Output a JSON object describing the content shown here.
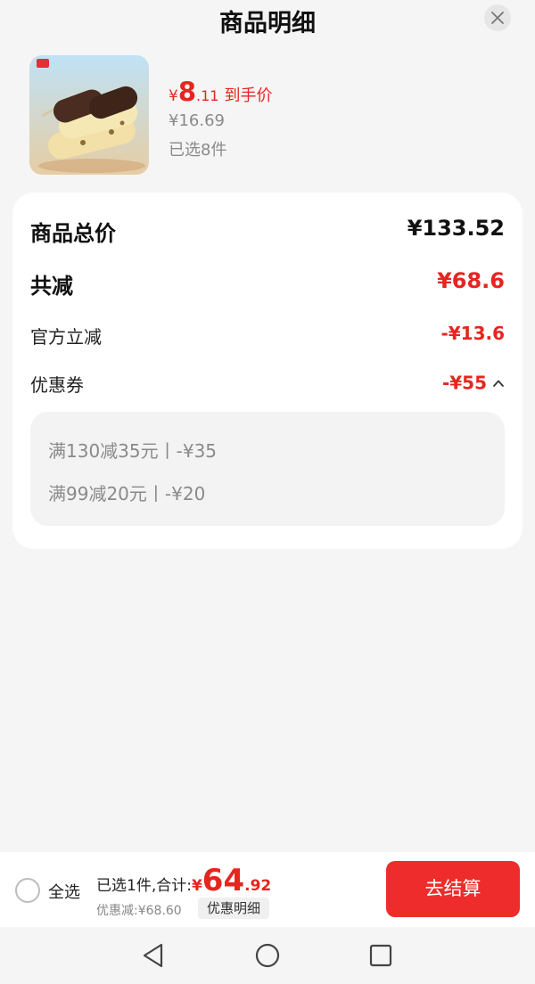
{
  "header": {
    "title": "商品明细"
  },
  "product": {
    "price_symbol": "¥",
    "price_int": "8",
    "price_dec": ".11",
    "price_tag": "到手价",
    "original_price": "¥16.69",
    "selected_qty": "已选8件"
  },
  "summary": {
    "total_label": "商品总价",
    "total_value": "¥133.52",
    "reduce_label": "共减",
    "reduce_value": "¥68.6",
    "official_label": "官方立减",
    "official_value": "-¥13.6",
    "coupon_label": "优惠券",
    "coupon_value": "-¥55",
    "coupons": [
      "满130减35元丨-¥35",
      "满99减20元丨-¥20"
    ]
  },
  "bottom": {
    "select_all": "全选",
    "summary_text": "已选1件,合计:",
    "sum_symbol": "¥",
    "sum_int": "64",
    "sum_dec": ".92",
    "discount_text": "优惠减:¥68.60",
    "detail_chip": "优惠明细",
    "checkout": "去结算"
  },
  "colors": {
    "accent": "#e5261f",
    "checkout_button": "#ee2c2c",
    "background": "#f5f5f5"
  }
}
